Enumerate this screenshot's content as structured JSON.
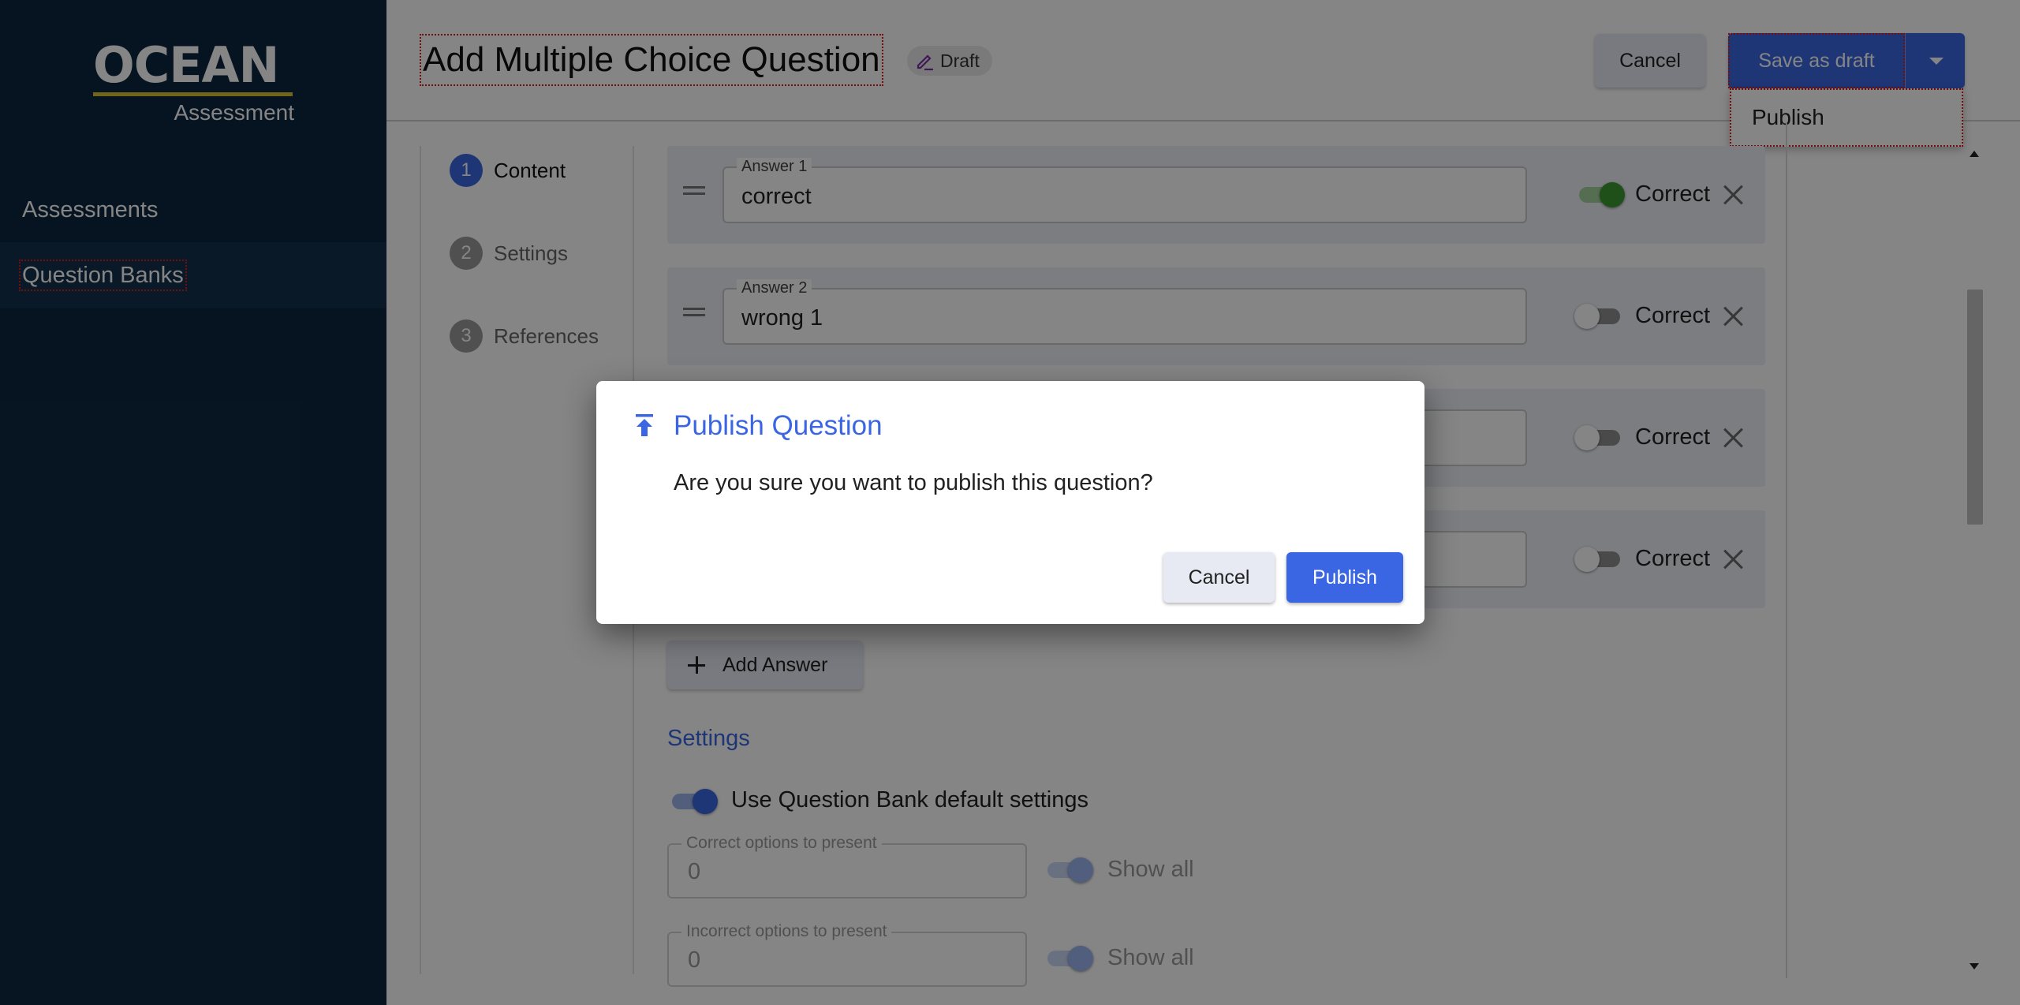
{
  "sidebar": {
    "logo": {
      "word": "OCEAN",
      "sub": "Assessment"
    },
    "items": [
      {
        "label": "Assessments"
      },
      {
        "label": "Question Banks",
        "active": true
      }
    ]
  },
  "header": {
    "title": "Add Multiple Choice Question",
    "badge": "Draft",
    "cancel_label": "Cancel",
    "save_draft_label": "Save as draft",
    "menu": [
      {
        "label": "Publish"
      }
    ]
  },
  "stepper": [
    {
      "number": "1",
      "label": "Content",
      "active": true
    },
    {
      "number": "2",
      "label": "Settings",
      "active": false
    },
    {
      "number": "3",
      "label": "References",
      "active": false
    }
  ],
  "answers": [
    {
      "label": "Answer 1",
      "value": "correct",
      "correct_label": "Correct",
      "correct": true
    },
    {
      "label": "Answer 2",
      "value": "wrong 1",
      "correct_label": "Correct",
      "correct": false
    },
    {
      "label": "",
      "value": "",
      "correct_label": "Correct",
      "correct": false
    },
    {
      "label": "",
      "value": "",
      "correct_label": "Correct",
      "correct": false
    }
  ],
  "add_answer_label": "Add Answer",
  "settings": {
    "heading": "Settings",
    "use_default_label": "Use Question Bank default settings",
    "use_default": true,
    "correct_options": {
      "label": "Correct options to present",
      "value": "0",
      "show_all_label": "Show all"
    },
    "incorrect_options": {
      "label": "Incorrect options to present",
      "value": "0",
      "show_all_label": "Show all"
    }
  },
  "dialog": {
    "title": "Publish Question",
    "body": "Are you sure you want to publish this question?",
    "cancel_label": "Cancel",
    "confirm_label": "Publish"
  },
  "colors": {
    "sidebar": "#0d2640",
    "accent": "#3a66e3",
    "correct_on": "#3e9a32",
    "logo_underline": "#d9c233"
  }
}
